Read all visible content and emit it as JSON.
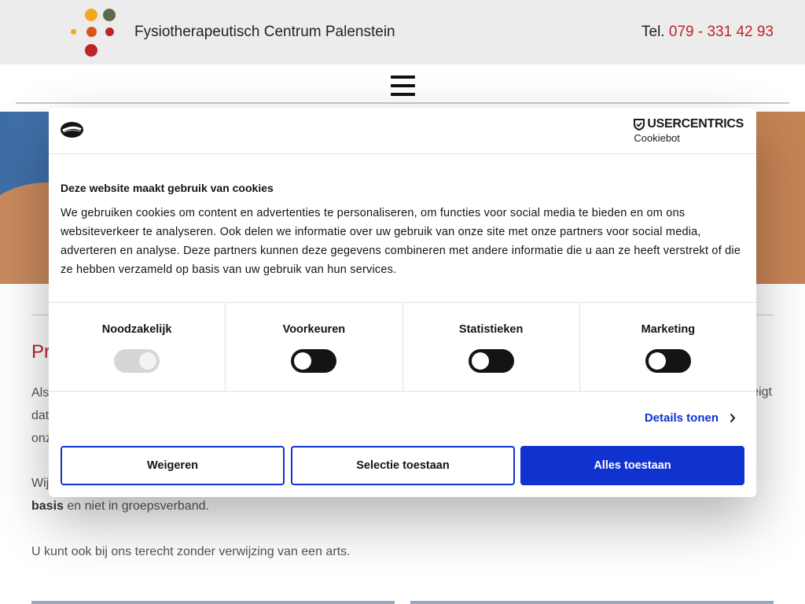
{
  "header": {
    "site_name": "Fysiotherapeutisch Centrum Palenstein",
    "phone_label": "Tel.",
    "phone_number": "079 - 331 42 93"
  },
  "background": {
    "heading_fragment": "Pr",
    "line1_left": "Als",
    "line1_right": "eigt",
    "line2_left": "dat",
    "line3_left": "onz",
    "line4_left": "Wij",
    "line5_bold": "basis",
    "line5_rest": " en niet in groepsverband.",
    "line6": "U kunt ook bij ons terecht zonder verwijzing van een arts."
  },
  "cookie_dialog": {
    "brand_name": "USERCENTRICS",
    "brand_sub": "Cookiebot",
    "title": "Deze website maakt gebruik van cookies",
    "description": "We gebruiken cookies om content en advertenties te personaliseren, om functies voor social media te bieden en om ons websiteverkeer te analyseren. Ook delen we informatie over uw gebruik van onze site met onze partners voor social media, adverteren en analyse. Deze partners kunnen deze gegevens combineren met andere informatie die u aan ze heeft verstrekt of die ze hebben verzameld op basis van uw gebruik van hun services.",
    "categories": [
      {
        "label": "Noodzakelijk",
        "checked": true,
        "disabled": true
      },
      {
        "label": "Voorkeuren",
        "checked": false,
        "disabled": false
      },
      {
        "label": "Statistieken",
        "checked": false,
        "disabled": false
      },
      {
        "label": "Marketing",
        "checked": false,
        "disabled": false
      }
    ],
    "details_label": "Details tonen",
    "buttons": {
      "reject": "Weigeren",
      "selection": "Selectie toestaan",
      "allow_all": "Alles toestaan"
    }
  },
  "colors": {
    "accent_red": "#c0222a",
    "cookiebot_blue": "#1032cf"
  }
}
